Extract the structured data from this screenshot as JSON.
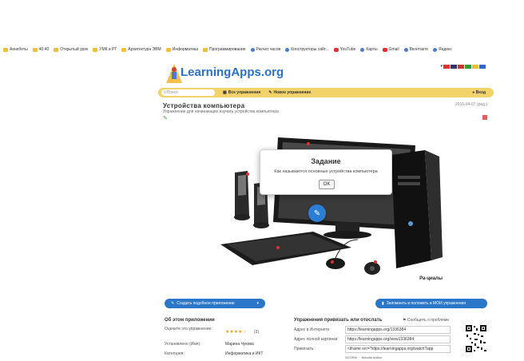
{
  "bookmarks": [
    {
      "label": "Ахнеботы",
      "icon": "bookmark-folder-icon"
    },
    {
      "label": "40:40",
      "icon": "bookmark-folder-icon"
    },
    {
      "label": "Открытый урок",
      "icon": "bookmark-folder-icon"
    },
    {
      "label": "УМК и РТ",
      "icon": "bookmark-folder-icon"
    },
    {
      "label": "Архитектура ЭВМ",
      "icon": "bookmark-folder-icon"
    },
    {
      "label": "Информатика",
      "icon": "bookmark-folder-icon"
    },
    {
      "label": "Программирование",
      "icon": "bookmark-folder-icon"
    },
    {
      "label": "Расчет часов",
      "icon": "globe-icon"
    },
    {
      "label": "Конструкторы сайт...",
      "icon": "globe-icon"
    },
    {
      "label": "YouTube",
      "icon": "youtube-icon"
    },
    {
      "label": "Карты",
      "icon": "maps-icon"
    },
    {
      "label": "Gmail",
      "icon": "gmail-icon"
    },
    {
      "label": "Вконтакте",
      "icon": "vk-icon"
    },
    {
      "label": "Яндекс",
      "icon": "globe-icon"
    }
  ],
  "site": {
    "logo": "LearningApps.org",
    "search_placeholder": "Поиск",
    "nav_all": "Все упражнения",
    "nav_new": "Новое упражнение",
    "login": "Вход"
  },
  "app": {
    "title": "Устройства компьютера",
    "subtitle": "Упражнение для начинающих изучать устройства компьютера",
    "date": "2016-04-07 (ред.)",
    "image_caption": "Ра-циалы"
  },
  "modal": {
    "title": "Задание",
    "text": "Как называются основные устройства компьютера",
    "ok": "OK"
  },
  "actions": {
    "create_similar": "Создать подобное приложение",
    "save": "Запомнить и положить в МОИ упражнения"
  },
  "about": {
    "heading": "Об этом приложении",
    "rate_label": "Оцените это упражнение:",
    "rating_count": "(3)",
    "author_label": "Установлено (Имя):",
    "author": "Марина Чукова",
    "category_label": "Категория:",
    "category": "Информатика и ИКТ"
  },
  "embed": {
    "heading": "Упражнения привязать или отослать",
    "report": "Сообщить о проблеме",
    "link_label": "Адрес в Интернете:",
    "link_value": "https://learningapps.org/1336384",
    "fullscreen_label": "Адрес полной картинки:",
    "fullscreen_value": "https://learningapps.org/view1336384",
    "embed_label": "Привязать:",
    "embed_value": "<iframe src=\"https://learningapps.org/watch?app",
    "scorm": "SCORM",
    "author_tool": "Moodle Author"
  },
  "colors": {
    "accent": "#2a77c9",
    "navbar": "#f2d36a",
    "logo": "#2c70c8"
  }
}
